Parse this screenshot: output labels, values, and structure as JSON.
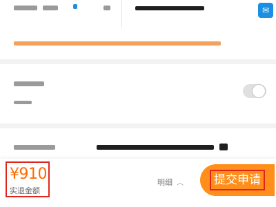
{
  "refund_bar": {
    "amount": "¥910",
    "amount_label": "实退金额",
    "detail_label": "明细",
    "submit_label": "提交申请"
  },
  "colors": {
    "accent": "#ff8f1a",
    "highlight_border": "#e1251b",
    "amount": "#ff6a00"
  },
  "icons": [
    "service-icon",
    "chevron-up-icon",
    "toggle-switch"
  ]
}
